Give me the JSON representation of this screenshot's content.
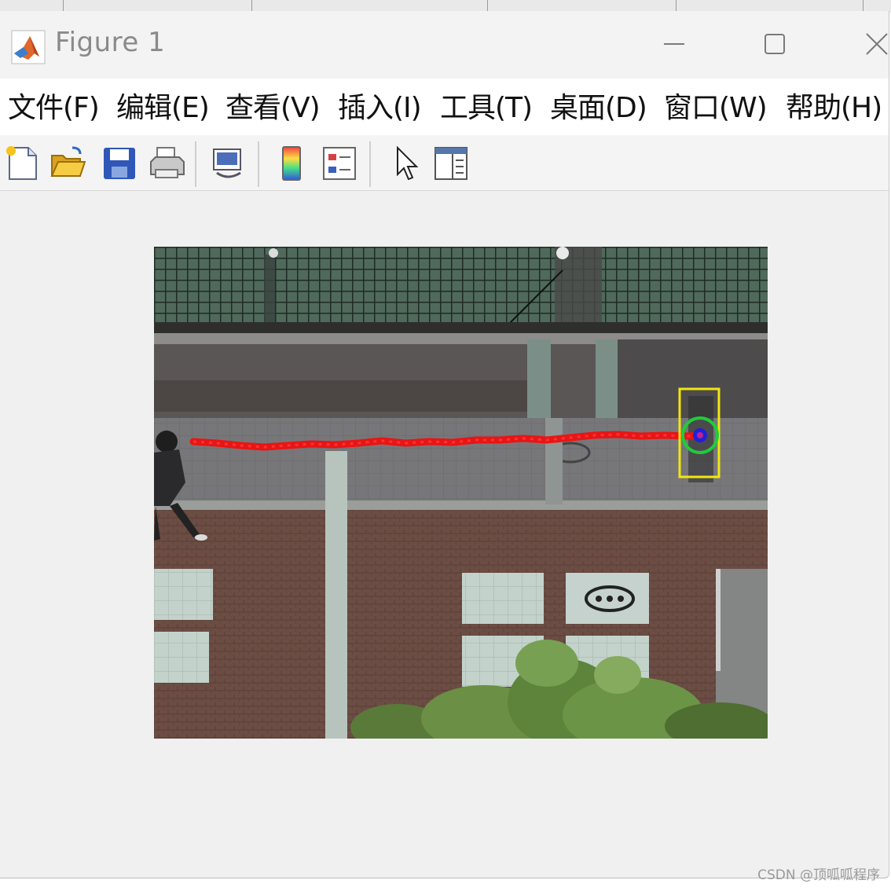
{
  "window": {
    "title": "Figure 1",
    "icon": "matlab-logo-icon",
    "controls": [
      "minimize-icon",
      "maximize-icon",
      "close-icon"
    ]
  },
  "menu": {
    "items": [
      "文件(F)",
      "编辑(E)",
      "查看(V)",
      "插入(I)",
      "工具(T)",
      "桌面(D)",
      "窗口(W)",
      "帮助(H)"
    ]
  },
  "toolbar": {
    "buttons": [
      "new-figure-icon",
      "open-file-icon",
      "save-icon",
      "print-icon",
      "link-plot-icon",
      "insert-colorbar-icon",
      "insert-legend-icon",
      "edit-plot-arrow-icon",
      "property-inspector-icon"
    ]
  },
  "figure": {
    "image": "overhead-walkway-tracking-frame",
    "track_color": "#e81515",
    "bbox_color": "#f2e60f",
    "circle_color": "#1fcc3a",
    "center_color": "#2020d8"
  },
  "watermark": "CSDN @顶呱呱程序"
}
